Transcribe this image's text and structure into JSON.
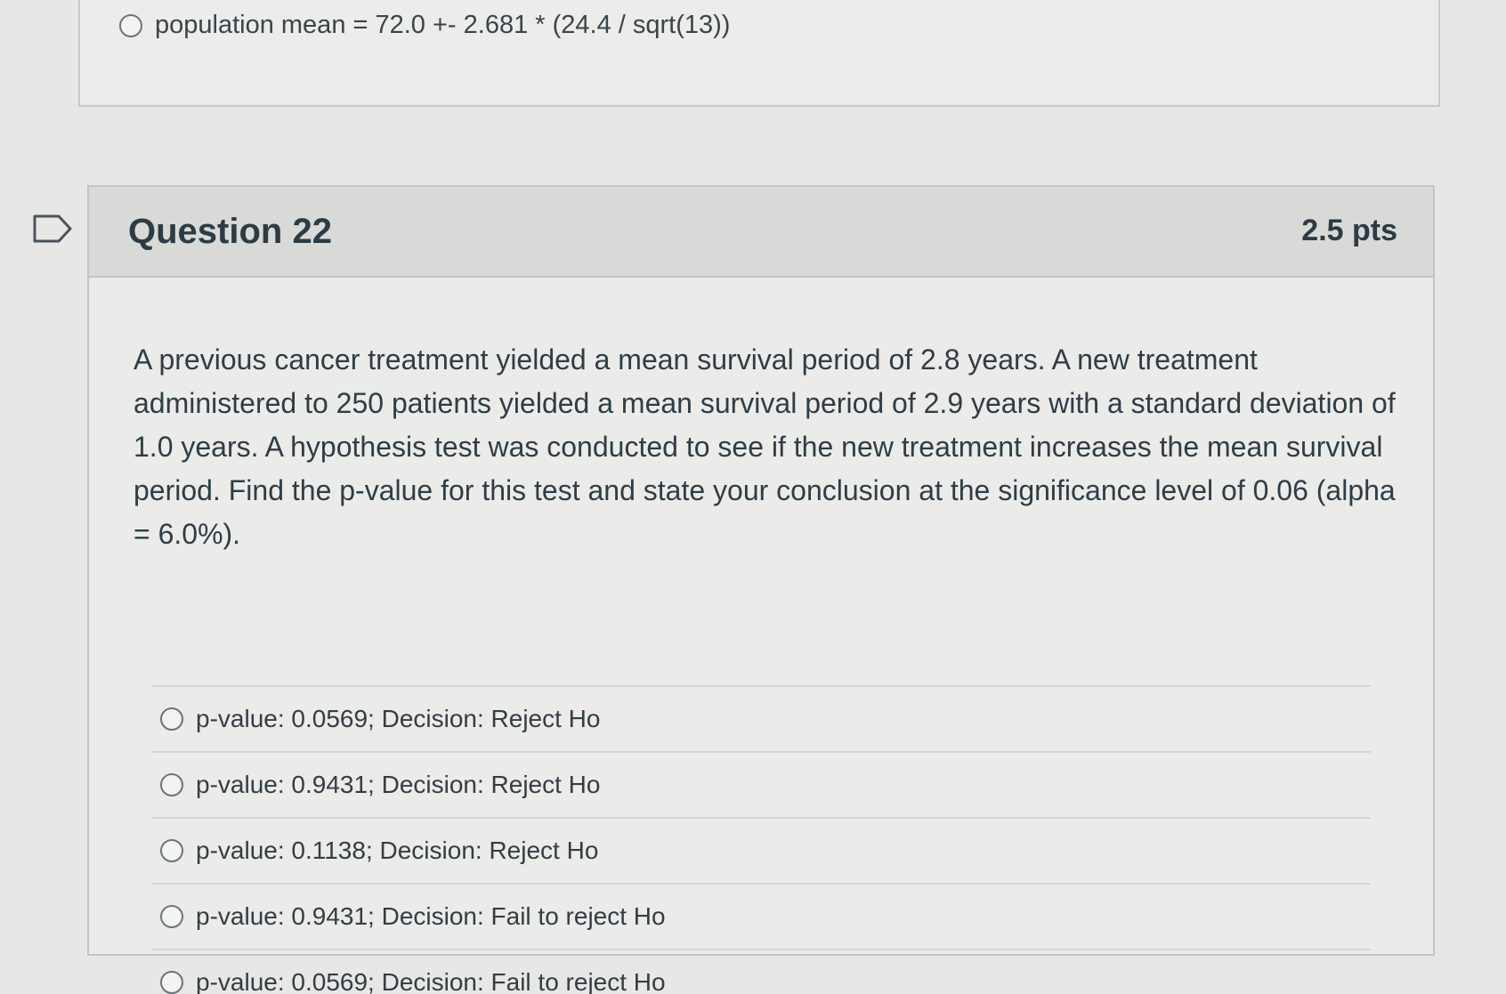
{
  "previous_question": {
    "answer_text": "population mean = 72.0 +- 2.681 * (24.4 / sqrt(13))"
  },
  "question": {
    "title": "Question 22",
    "points": "2.5 pts",
    "text": "A previous cancer treatment yielded a mean survival period of 2.8 years. A new treatment administered to 250 patients yielded a mean survival period of 2.9 years with a standard deviation of 1.0 years. A hypothesis test was conducted to see if the new treatment increases the mean survival period. Find the p-value for this test and state your conclusion at the significance level of 0.06 (alpha = 6.0%).",
    "answers": [
      {
        "label": "p-value: 0.0569; Decision: Reject Ho"
      },
      {
        "label": "p-value: 0.9431; Decision: Reject Ho"
      },
      {
        "label": "p-value: 0.1138; Decision: Reject Ho"
      },
      {
        "label": "p-value: 0.9431; Decision: Fail to reject Ho"
      },
      {
        "label": "p-value: 0.0569; Decision: Fail to reject Ho"
      }
    ]
  },
  "icons": {
    "flag": "bookmark-flag-icon",
    "radio": "radio-button-icon"
  },
  "colors": {
    "background": "#e7e7e5",
    "header": "#d9d9d7",
    "text": "#2d3b45"
  }
}
